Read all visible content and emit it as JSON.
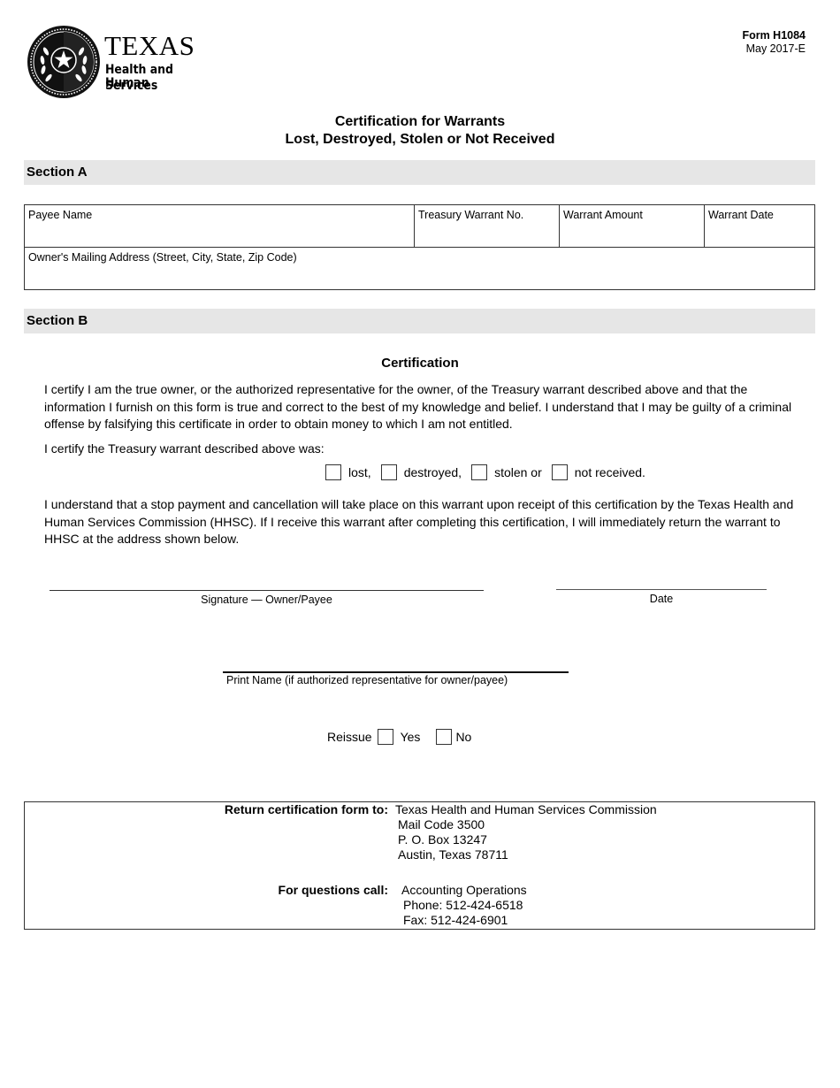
{
  "header": {
    "logo": {
      "icon": "texas-state-seal-icon",
      "line1": "TEXAS",
      "line2": "Health and Human",
      "line3": "Services"
    },
    "form_number": "Form H1084",
    "form_date": "May 2017-E",
    "title_line1": "Certification for Warrants",
    "title_line2": "Lost, Destroyed, Stolen or Not Received"
  },
  "section_a": {
    "heading": "Section A",
    "fields": {
      "payee_name": {
        "label": "Payee Name",
        "value": ""
      },
      "treasury_warrant_no": {
        "label": "Treasury Warrant No.",
        "value": ""
      },
      "warrant_amount": {
        "label": "Warrant Amount",
        "value": ""
      },
      "warrant_date": {
        "label": "Warrant Date",
        "value": ""
      },
      "mailing_address": {
        "label": "Owner's Mailing Address (Street, City, State, Zip Code)",
        "value": ""
      }
    }
  },
  "section_b": {
    "heading": "Section B",
    "certification_heading": "Certification",
    "paragraph1": "I certify I am the true owner, or the authorized representative for the owner, of the Treasury warrant described above and that the information I furnish on this form is true and correct to the best of my knowledge and belief. I understand that I may be guilty of a criminal offense by falsifying this certificate in order to obtain money to which I am not entitled.",
    "paragraph2": "I certify the Treasury warrant described above was:",
    "options": [
      {
        "label": "lost,",
        "checked": false
      },
      {
        "label": "destroyed,",
        "checked": false
      },
      {
        "label": "stolen or",
        "checked": false
      },
      {
        "label": "not received.",
        "checked": false
      }
    ],
    "paragraph3": "I understand that a stop payment and cancellation will take place on this warrant upon receipt of this certification by the Texas Health and Human Services Commission (HHSC). If I receive this warrant after completing this certification, I will immediately return the warrant to HHSC at the address shown below.",
    "signature_label": "Signature — Owner/Payee",
    "date_label": "Date",
    "print_name_label": "Print Name (if authorized representative for owner/payee)",
    "reissue": {
      "label": "Reissue",
      "yes_label": "Yes",
      "no_label": "No",
      "yes_checked": false,
      "no_checked": false
    }
  },
  "return_info": {
    "return_label": "Return certification form to:",
    "return_lines": [
      "Texas Health and Human Services Commission",
      "Mail Code 3500",
      "P. O. Box 13247",
      "Austin, Texas 78711"
    ],
    "questions_label": "For questions call:",
    "questions_lines": [
      "Accounting Operations",
      "Phone: 512-424-6518",
      "Fax: 512-424-6901"
    ]
  }
}
